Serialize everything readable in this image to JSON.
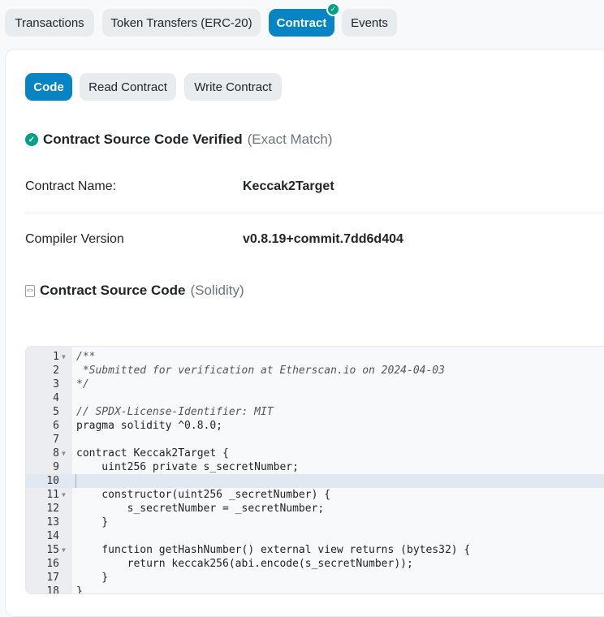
{
  "tabs": [
    {
      "label": "Transactions"
    },
    {
      "label": "Token Transfers (ERC-20)"
    },
    {
      "label": "Contract",
      "active": true,
      "verified_icon": "check-circle-icon"
    },
    {
      "label": "Events"
    }
  ],
  "subtabs": [
    {
      "label": "Code",
      "active": true
    },
    {
      "label": "Read Contract"
    },
    {
      "label": "Write Contract"
    }
  ],
  "verified": {
    "title": "Contract Source Code Verified",
    "note": "(Exact Match)"
  },
  "fields": [
    {
      "label": "Contract Name:",
      "value": "Keccak2Target"
    },
    {
      "label": "Compiler Version",
      "value": "v0.8.19+commit.7dd6d404"
    }
  ],
  "source": {
    "title": "Contract Source Code",
    "language": "(Solidity)"
  },
  "editor": {
    "current_line": 10,
    "lines": [
      {
        "n": "1",
        "text": "/**",
        "fold": true,
        "comment": true
      },
      {
        "n": "2",
        "text": " *Submitted for verification at Etherscan.io on 2024-04-03",
        "comment": true
      },
      {
        "n": "3",
        "text": "*/",
        "comment": true
      },
      {
        "n": "4",
        "text": ""
      },
      {
        "n": "5",
        "text": "// SPDX-License-Identifier: MIT",
        "comment": true
      },
      {
        "n": "6",
        "text": "pragma solidity ^0.8.0;"
      },
      {
        "n": "7",
        "text": ""
      },
      {
        "n": "8",
        "text": "contract Keccak2Target {",
        "fold": true
      },
      {
        "n": "9",
        "text": "    uint256 private s_secretNumber;"
      },
      {
        "n": "10",
        "text": ""
      },
      {
        "n": "11",
        "text": "    constructor(uint256 _secretNumber) {",
        "fold": true
      },
      {
        "n": "12",
        "text": "        s_secretNumber = _secretNumber;"
      },
      {
        "n": "13",
        "text": "    }"
      },
      {
        "n": "14",
        "text": ""
      },
      {
        "n": "15",
        "text": "    function getHashNumber() external view returns (bytes32) {",
        "fold": true
      },
      {
        "n": "16",
        "text": "        return keccak256(abi.encode(s_secretNumber));"
      },
      {
        "n": "17",
        "text": "    }"
      },
      {
        "n": "18",
        "text": "}"
      }
    ]
  }
}
